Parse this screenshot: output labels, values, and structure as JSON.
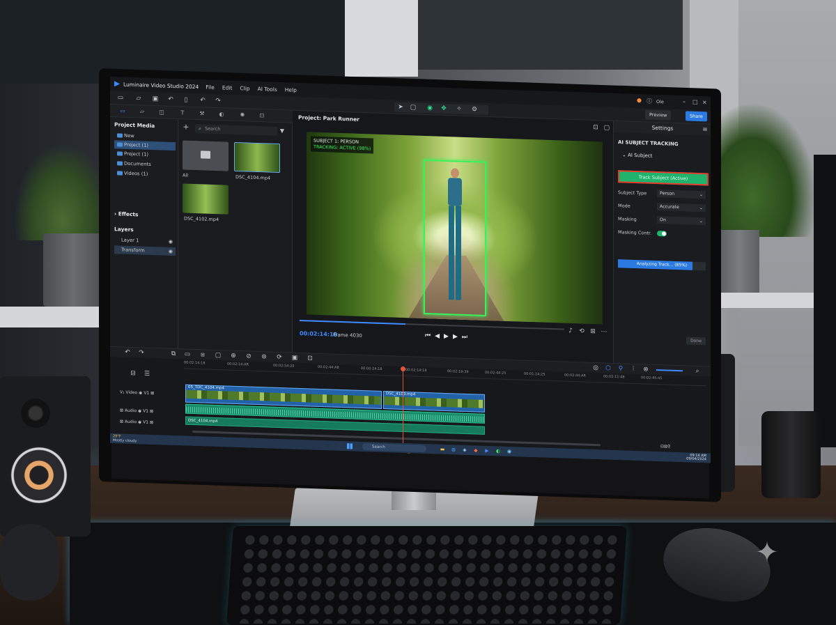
{
  "window": {
    "app_title": "Luminaire Video Studio 2024",
    "menu": [
      "File",
      "Edit",
      "Clip",
      "AI Tools",
      "Help"
    ],
    "user": "Ole"
  },
  "toolbar": {
    "preview_label": "Preview",
    "share_label": "Share"
  },
  "project_media": {
    "title": "Project Media",
    "tree": [
      "New",
      "Project (1)",
      "Project (1)",
      "Documents",
      "Videos (1)"
    ],
    "selected_index": 1,
    "effects_label": "Effects",
    "layers_title": "Layers",
    "layers": [
      "Layer 1",
      "Transform"
    ],
    "search_placeholder": "Search",
    "items": [
      {
        "label": "All",
        "kind": "folder"
      },
      {
        "label": "DSC_4104.mp4",
        "kind": "video"
      },
      {
        "label": "DSC_4102.mp4",
        "kind": "video"
      }
    ]
  },
  "preview": {
    "title": "Project: Park Runner",
    "overlay_line1": "SUBJECT 1: PERSON",
    "overlay_line2": "TRACKING: ACTIVE (98%)",
    "timecode": "00:02:14:18",
    "frame": "Frame 4030",
    "progress": 0.4
  },
  "settings": {
    "header": "Settings",
    "section": "AI SUBJECT TRACKING",
    "subsection": "AI Subject",
    "track_button": "Track Subject (Active)",
    "rows": [
      {
        "label": "Subject Type",
        "value": "Person"
      },
      {
        "label": "Mode",
        "value": "Accurate"
      },
      {
        "label": "Masking",
        "value": "On"
      }
    ],
    "masking_control_label": "Masking Contr.",
    "analyzing_label": "Analyzing Track... (85%)",
    "analyzing_progress": 0.85,
    "done_label": "Done"
  },
  "timeline": {
    "ruler": [
      "00:02:14:18",
      "00:02:14:AR",
      "00:02:54:20",
      "00:02:44:A8",
      "00:00:24:18",
      "00:02:14:18",
      "00:02:19:39",
      "00:02:44:25",
      "00:01:14:25",
      "00:02:44:AR",
      "00:02:11:48",
      "00:02:45:45"
    ],
    "video_track": "Video",
    "audio_tracks": [
      "Audio",
      "Audio"
    ],
    "video_clips": [
      "05_TDC_4104.mp4",
      "DSC_4103.mp4"
    ],
    "audio_clip": "DSC_4104.mp4"
  },
  "taskbar": {
    "search_placeholder": "Search",
    "weather": [
      "29°F",
      "Mostly cloudy"
    ],
    "clock": [
      "09:14 AM",
      "09/04/2024"
    ]
  }
}
